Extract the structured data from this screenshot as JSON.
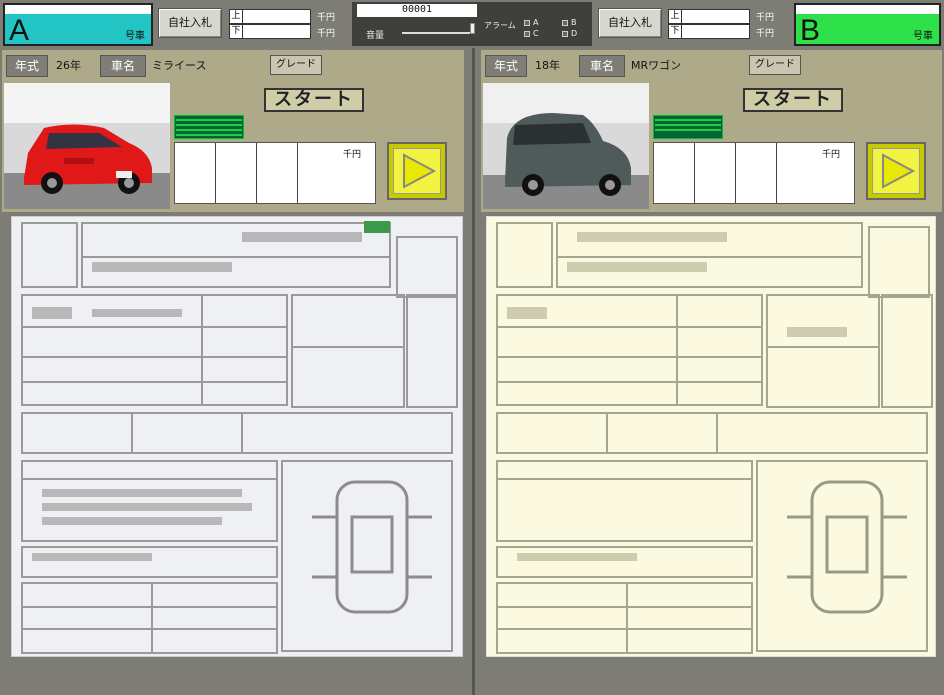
{
  "lane_a": {
    "letter": "A",
    "suffix": "号車",
    "color": "#23c4c4"
  },
  "lane_b": {
    "letter": "B",
    "suffix": "号車",
    "color": "#2ee04a"
  },
  "bid_a": {
    "button": "自社入札",
    "upper_label": "上",
    "lower_label": "下",
    "unit": "千円"
  },
  "bid_b": {
    "button": "自社入札",
    "upper_label": "上",
    "lower_label": "下",
    "unit": "千円"
  },
  "center": {
    "counter": "00001",
    "volume_label": "音量",
    "alarm_label": "アラーム",
    "alarm_options": [
      "A",
      "B",
      "C",
      "D"
    ]
  },
  "left": {
    "year_label": "年式",
    "year_value": "26年",
    "name_label": "車名",
    "name_value": "ミライース",
    "grade_label": "グレード",
    "start_label": "スタート",
    "amount_unit": "千円",
    "meter_bars": 5
  },
  "right": {
    "year_label": "年式",
    "year_value": "18年",
    "name_label": "車名",
    "name_value": "MRワゴン",
    "grade_label": "グレード",
    "start_label": "スタート",
    "amount_unit": "千円",
    "meter_bars": 4
  },
  "colors": {
    "panel": "#aea989",
    "sheet_left": "#eef0f3",
    "sheet_right": "#fbfae0",
    "car_left": "#e01818",
    "car_right": "#4f5a5a"
  }
}
